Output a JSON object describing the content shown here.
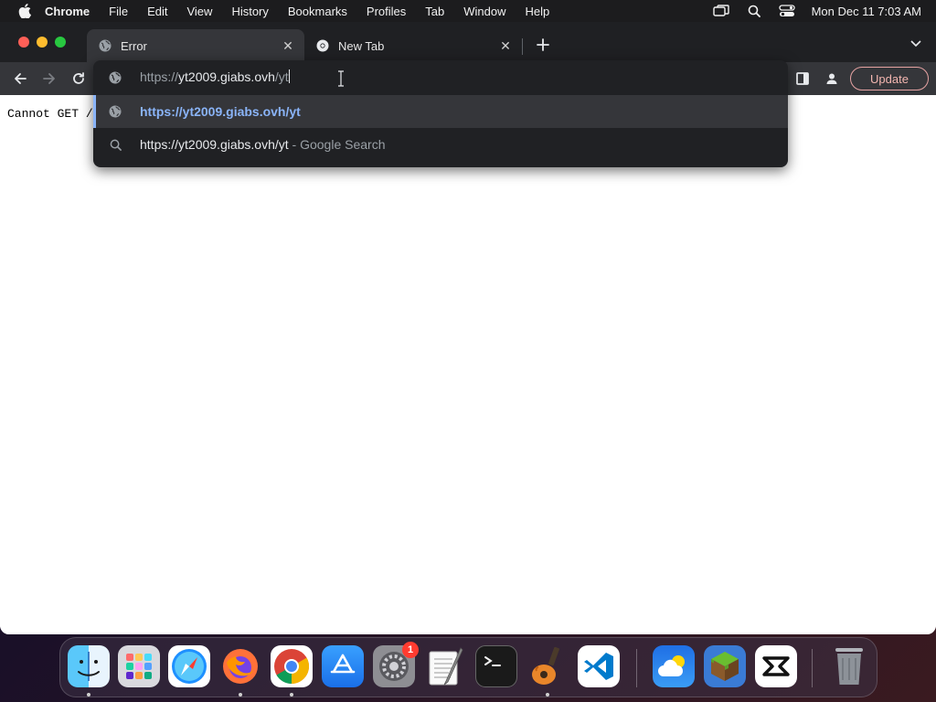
{
  "menubar": {
    "app_name": "Chrome",
    "items": [
      "File",
      "Edit",
      "View",
      "History",
      "Bookmarks",
      "Profiles",
      "Tab",
      "Window",
      "Help"
    ],
    "clock": "Mon Dec 11  7:03 AM"
  },
  "browser": {
    "tabs": [
      {
        "title": "Error",
        "favicon": "globe-icon",
        "active": true
      },
      {
        "title": "New Tab",
        "favicon": "chrome-icon",
        "active": false
      }
    ],
    "toolbar": {
      "update_label": "Update"
    },
    "omnibox": {
      "typed_prefix": "https://",
      "typed_host": "yt2009.giabs.ovh",
      "typed_path": "/yt",
      "suggestions": [
        {
          "type": "url",
          "icon": "globe-icon",
          "text": "https://yt2009.giabs.ovh/yt",
          "hint": "",
          "selected": true
        },
        {
          "type": "search",
          "icon": "search-icon",
          "text": "https://yt2009.giabs.ovh/yt",
          "hint": " - Google Search",
          "selected": false
        }
      ]
    },
    "page": {
      "body_text": "Cannot GET /"
    }
  },
  "dock": {
    "apps": [
      {
        "name": "Finder",
        "running": true
      },
      {
        "name": "Launchpad",
        "running": false
      },
      {
        "name": "Safari",
        "running": false
      },
      {
        "name": "Firefox",
        "running": true
      },
      {
        "name": "Chrome",
        "running": true
      },
      {
        "name": "App Store",
        "running": false
      },
      {
        "name": "System Settings",
        "running": false,
        "badge": "1"
      },
      {
        "name": "TextEdit",
        "running": false
      },
      {
        "name": "Terminal",
        "running": false
      },
      {
        "name": "GarageBand",
        "running": true
      },
      {
        "name": "Visual Studio Code",
        "running": false
      },
      {
        "name": "Weather",
        "running": false
      },
      {
        "name": "Minecraft",
        "running": false
      },
      {
        "name": "CapCut",
        "running": false
      },
      {
        "name": "Trash",
        "running": false
      }
    ]
  }
}
